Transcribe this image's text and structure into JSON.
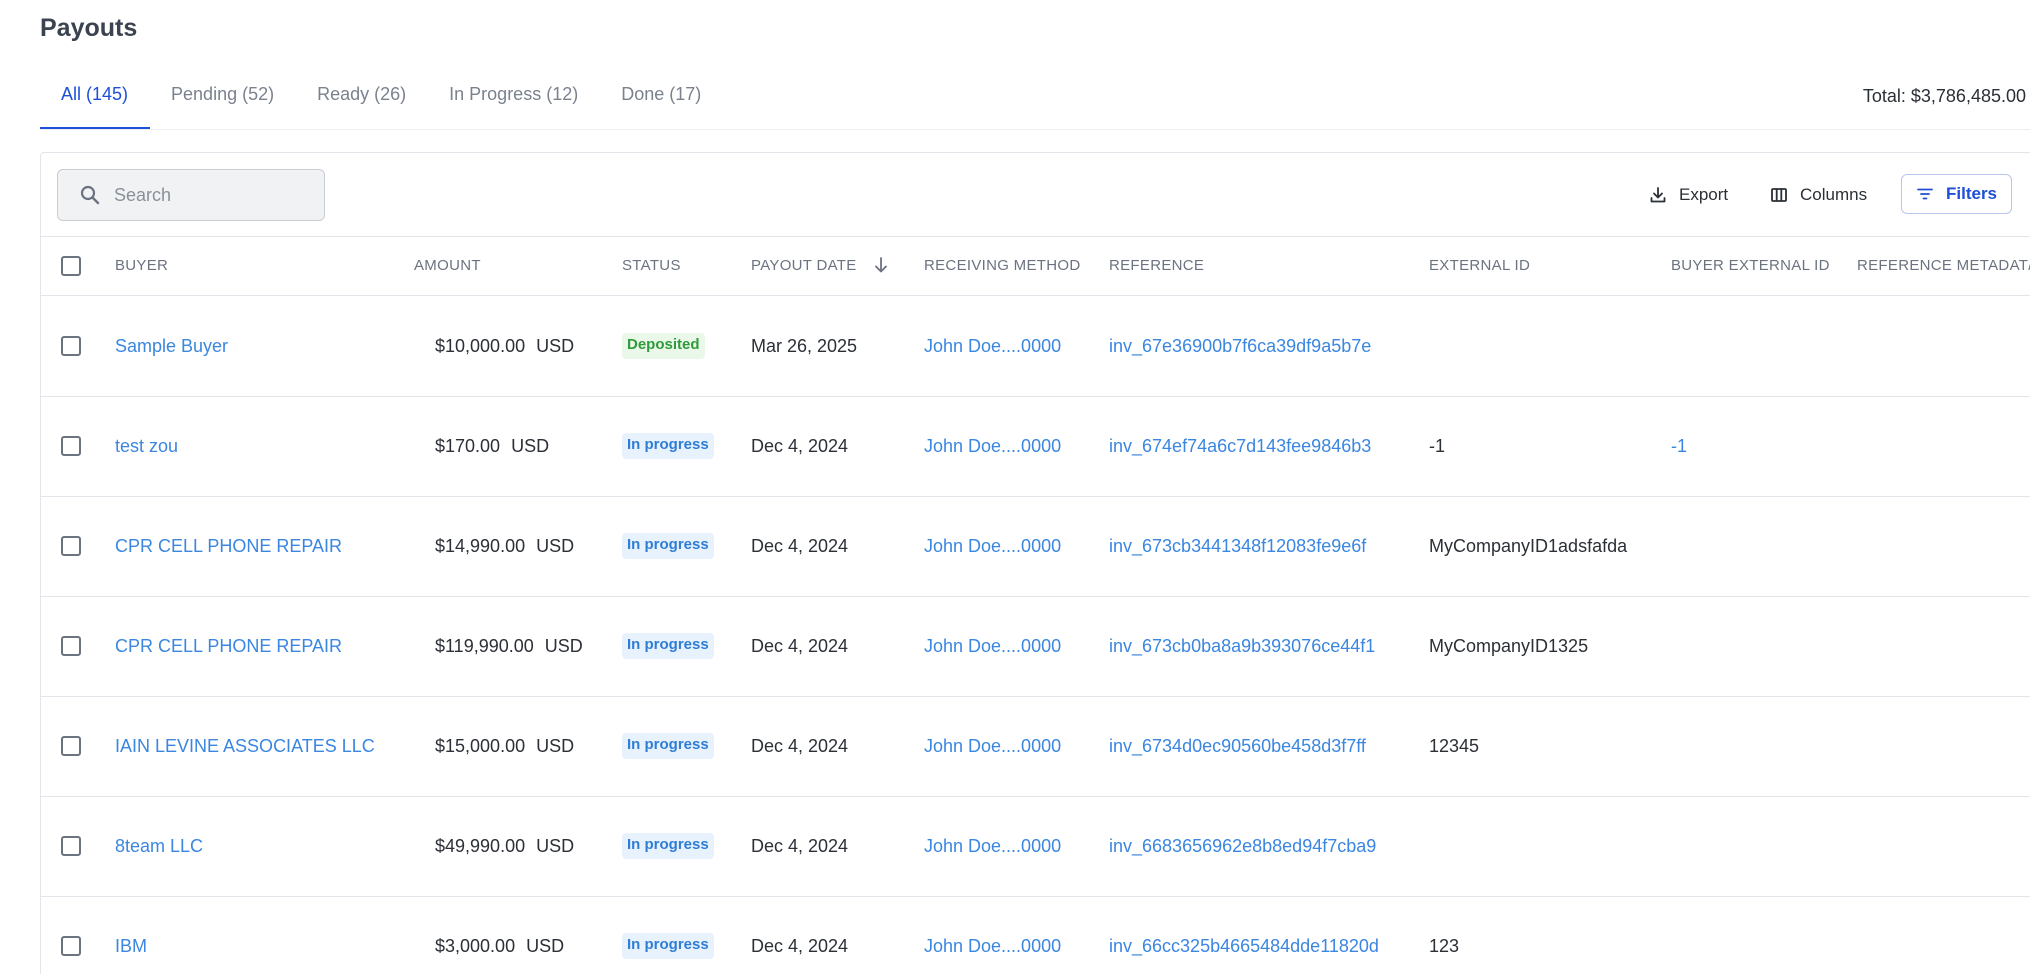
{
  "page": {
    "title": "Payouts"
  },
  "tabs": [
    {
      "label": "All (145)",
      "active": true
    },
    {
      "label": "Pending (52)"
    },
    {
      "label": "Ready (26)"
    },
    {
      "label": "In Progress (12)"
    },
    {
      "label": "Done (17)"
    }
  ],
  "total": "Total: $3,786,485.00",
  "toolbar": {
    "search_placeholder": "Search",
    "export_label": "Export",
    "columns_label": "Columns",
    "filters_label": "Filters"
  },
  "columns": {
    "buyer": "BUYER",
    "amount": "AMOUNT",
    "status": "STATUS",
    "payout_date": "PAYOUT DATE",
    "receiving_method": "RECEIVING METHOD",
    "reference": "REFERENCE",
    "external_id": "EXTERNAL ID",
    "buyer_external_id": "BUYER EXTERNAL ID",
    "reference_metadata": "REFERENCE METADAT/"
  },
  "rows": [
    {
      "buyer": "Sample Buyer",
      "amount": "$10,000.00",
      "currency": "USD",
      "status": "Deposited",
      "date": "Mar 26, 2025",
      "method": "John Doe....0000",
      "reference": "inv_67e36900b7f6ca39df9a5b7e",
      "external_id": "",
      "buyer_external_id": ""
    },
    {
      "buyer": "test zou",
      "amount": "$170.00",
      "currency": "USD",
      "status": "In progress",
      "date": "Dec 4, 2024",
      "method": "John Doe....0000",
      "reference": "inv_674ef74a6c7d143fee9846b3",
      "external_id": "-1",
      "buyer_external_id": "-1"
    },
    {
      "buyer": "CPR CELL PHONE REPAIR",
      "amount": "$14,990.00",
      "currency": "USD",
      "status": "In progress",
      "date": "Dec 4, 2024",
      "method": "John Doe....0000",
      "reference": "inv_673cb3441348f12083fe9e6f",
      "external_id": "MyCompanyID1adsfafda",
      "buyer_external_id": ""
    },
    {
      "buyer": "CPR CELL PHONE REPAIR",
      "amount": "$119,990.00",
      "currency": "USD",
      "status": "In progress",
      "date": "Dec 4, 2024",
      "method": "John Doe....0000",
      "reference": "inv_673cb0ba8a9b393076ce44f1",
      "external_id": "MyCompanyID1325",
      "buyer_external_id": ""
    },
    {
      "buyer": "IAIN LEVINE ASSOCIATES LLC",
      "amount": "$15,000.00",
      "currency": "USD",
      "status": "In progress",
      "date": "Dec 4, 2024",
      "method": "John Doe....0000",
      "reference": "inv_6734d0ec90560be458d3f7ff",
      "external_id": "12345",
      "buyer_external_id": ""
    },
    {
      "buyer": "8team LLC",
      "amount": "$49,990.00",
      "currency": "USD",
      "status": "In progress",
      "date": "Dec 4, 2024",
      "method": "John Doe....0000",
      "reference": "inv_6683656962e8b8ed94f7cba9",
      "external_id": "",
      "buyer_external_id": ""
    },
    {
      "buyer": "IBM",
      "amount": "$3,000.00",
      "currency": "USD",
      "status": "In progress",
      "date": "Dec 4, 2024",
      "method": "John Doe....0000",
      "reference": "inv_66cc325b4665484dde11820d",
      "external_id": "123",
      "buyer_external_id": ""
    }
  ],
  "icons": {
    "search": "search-icon",
    "export": "download-icon",
    "columns": "columns-icon",
    "filters": "filter-icon",
    "sort": "arrow-down-icon",
    "flag": "us-flag-icon"
  },
  "colors": {
    "accent": "#1d4fd8",
    "link": "#3a86e0",
    "deposited_bg": "#eaf8ea",
    "deposited_text": "#2f9b3a",
    "progress_bg": "#e8f2fd",
    "progress_text": "#2f7ed6"
  }
}
